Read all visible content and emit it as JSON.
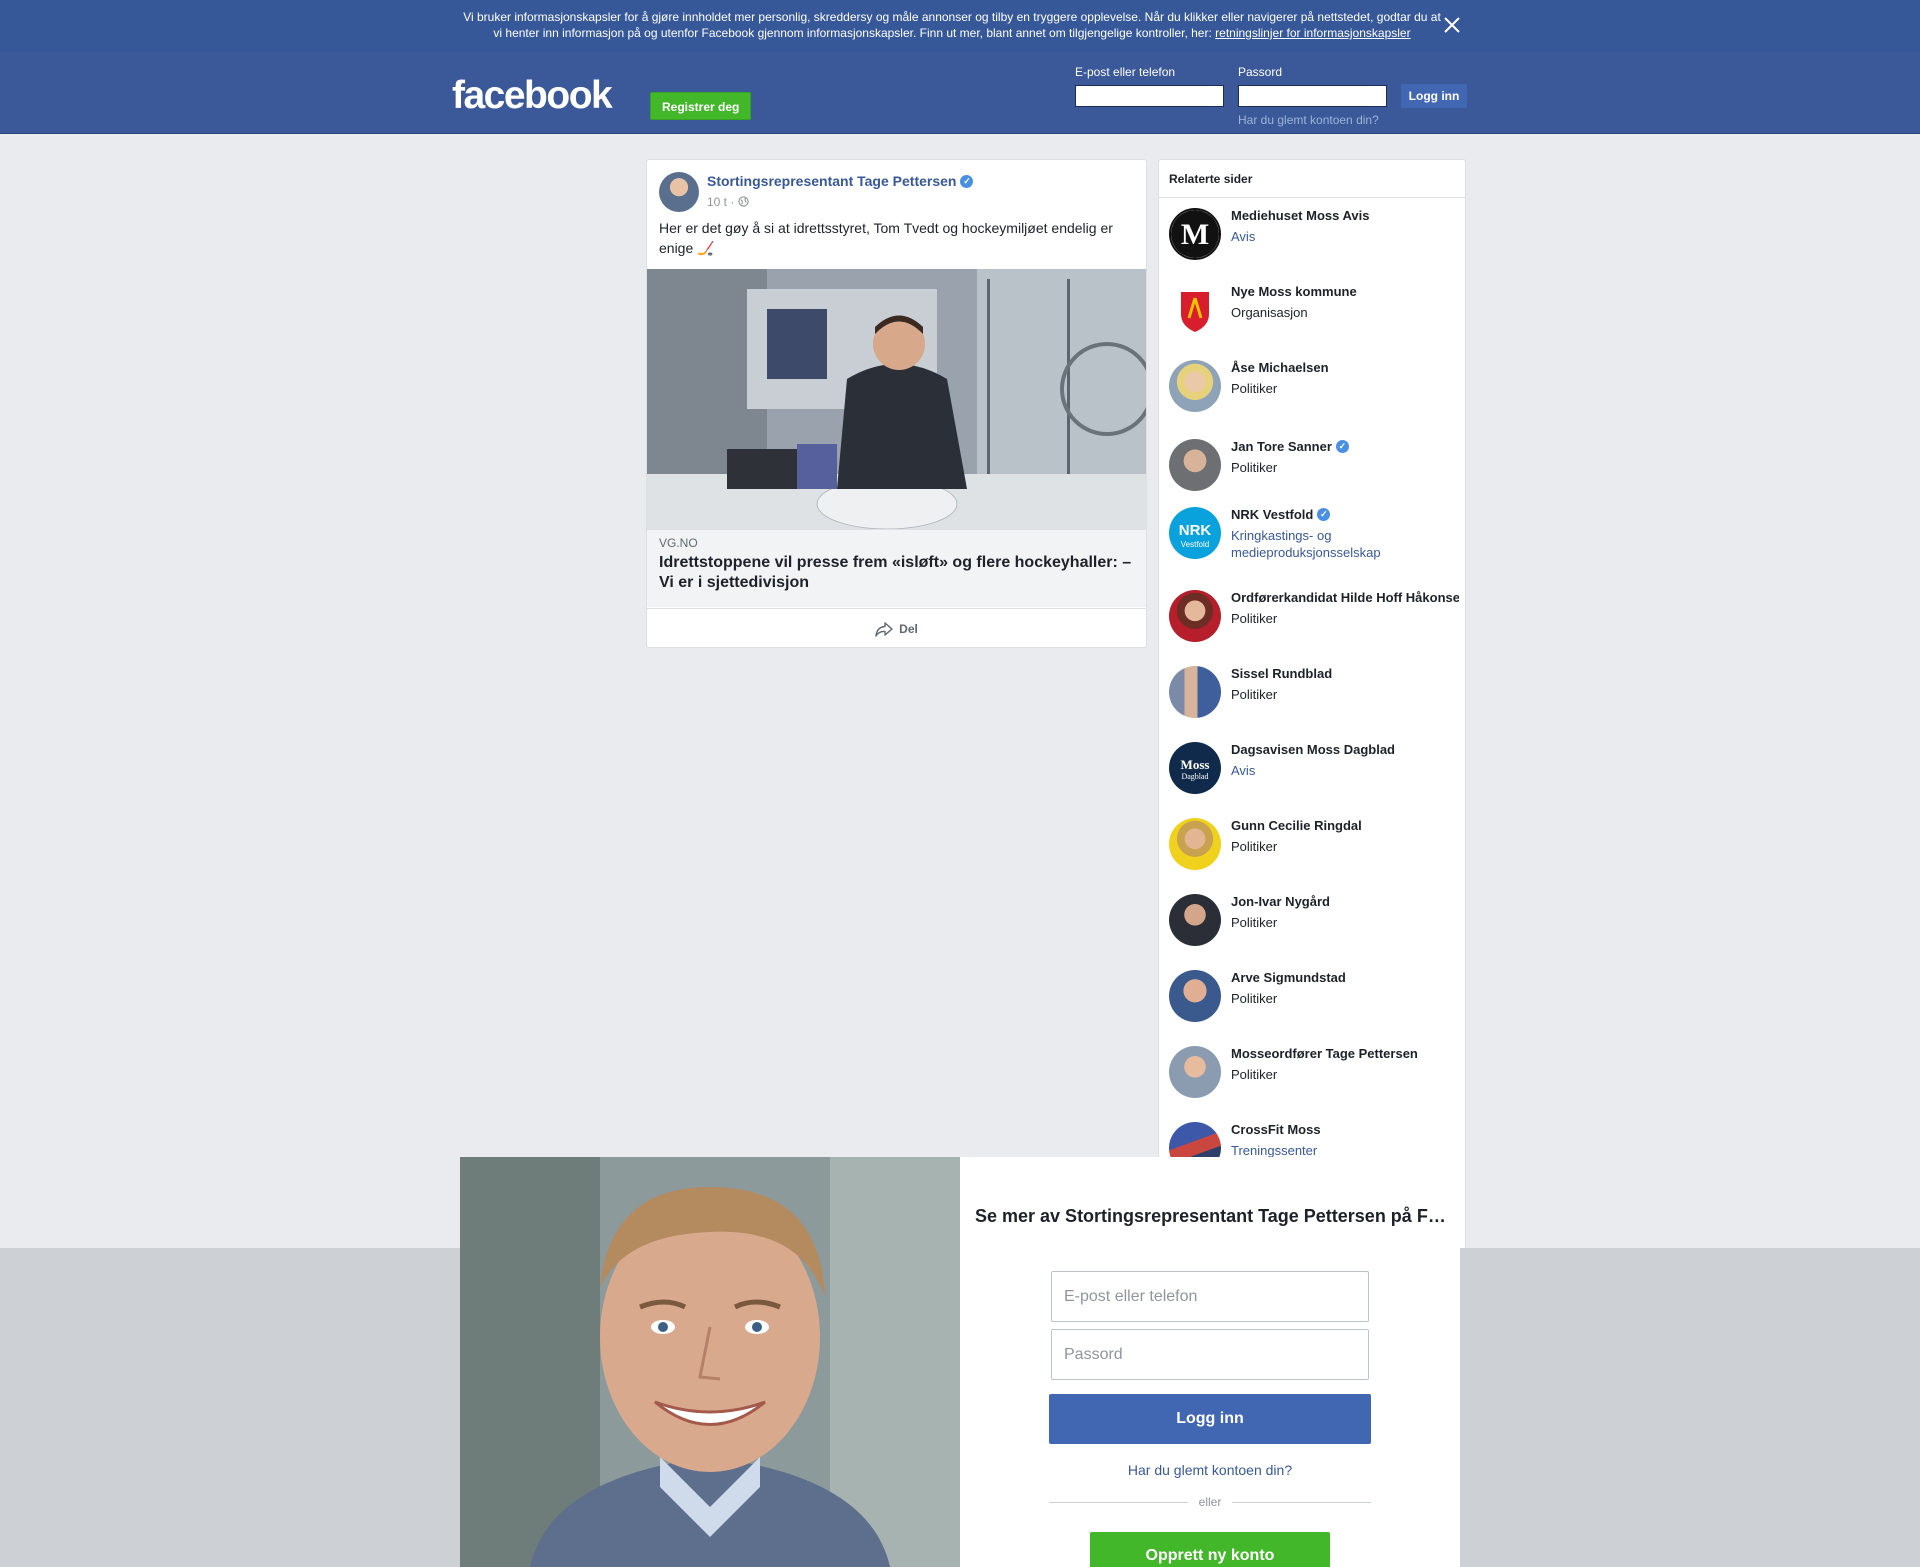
{
  "cookie_banner": {
    "text_line1": "Vi bruker informasjonskapsler for å gjøre innholdet mer personlig, skreddersy og måle annonser og tilby en tryggere opplevelse. Når du klikker eller navigerer på nettstedet, godtar du at",
    "text_line2": "vi henter inn informasjon på og utenfor Facebook gjennom informasjonskapsler. Finn ut mer, blant annet om tilgjengelige kontroller, her: ",
    "link": "retningslinjer for informasjonskapsler"
  },
  "header": {
    "logo": "facebook",
    "register_label": "Registrer deg",
    "email_label": "E-post eller telefon",
    "password_label": "Passord",
    "login_label": "Logg inn",
    "forgot_label": "Har du glemt kontoen din?"
  },
  "post": {
    "author": "Stortingsrepresentant Tage Pettersen",
    "time": "10 t · ",
    "text": "Her er det gøy å si at idrettsstyret, Tom Tvedt og hockeymiljøet endelig er enige 🏒",
    "link_domain": "VG.NO",
    "link_title": "Idrettstoppene vil presse frem «isløft» og flere hockeyhaller: – Vi er i sjettedivisjon",
    "share_label": "Del"
  },
  "related": {
    "title": "Relaterte sider",
    "items": [
      {
        "name": "Mediehuset Moss Avis",
        "category": "Avis",
        "link": true,
        "verified": false
      },
      {
        "name": "Nye Moss kommune",
        "category": "Organisasjon",
        "link": false,
        "verified": false
      },
      {
        "name": "Åse Michaelsen",
        "category": "Politiker",
        "link": false,
        "verified": false
      },
      {
        "name": "Jan Tore Sanner",
        "category": "Politiker",
        "link": false,
        "verified": true
      },
      {
        "name": "NRK Vestfold",
        "category": "Kringkastings- og medieproduksjonsselskap",
        "link": true,
        "verified": true
      },
      {
        "name": "Ordførerkandidat Hilde Hoff Håkonsen",
        "category": "Politiker",
        "link": false,
        "verified": false
      },
      {
        "name": "Sissel Rundblad",
        "category": "Politiker",
        "link": false,
        "verified": false
      },
      {
        "name": "Dagsavisen Moss Dagblad",
        "category": "Avis",
        "link": true,
        "verified": false
      },
      {
        "name": "Gunn Cecilie Ringdal",
        "category": "Politiker",
        "link": false,
        "verified": false
      },
      {
        "name": "Jon-Ivar Nygård",
        "category": "Politiker",
        "link": false,
        "verified": false
      },
      {
        "name": "Arve Sigmundstad",
        "category": "Politiker",
        "link": false,
        "verified": false
      },
      {
        "name": "Mosseordfører Tage Pettersen",
        "category": "Politiker",
        "link": false,
        "verified": false
      },
      {
        "name": "CrossFit Moss",
        "category": "Treningssenter",
        "link": true,
        "verified": false
      }
    ]
  },
  "modal": {
    "title": "Se mer av Stortingsrepresentant Tage Pettersen på Facebook",
    "email_placeholder": "E-post eller telefon",
    "password_placeholder": "Passord",
    "login_label": "Logg inn",
    "forgot_label": "Har du glemt kontoen din?",
    "or_label": "eller",
    "create_label": "Opprett ny konto"
  },
  "colors": {
    "brand_blue": "#3b5998",
    "banner_blue": "#365899",
    "button_blue": "#4267b2",
    "green": "#42b72a",
    "link_blue": "#385898"
  }
}
